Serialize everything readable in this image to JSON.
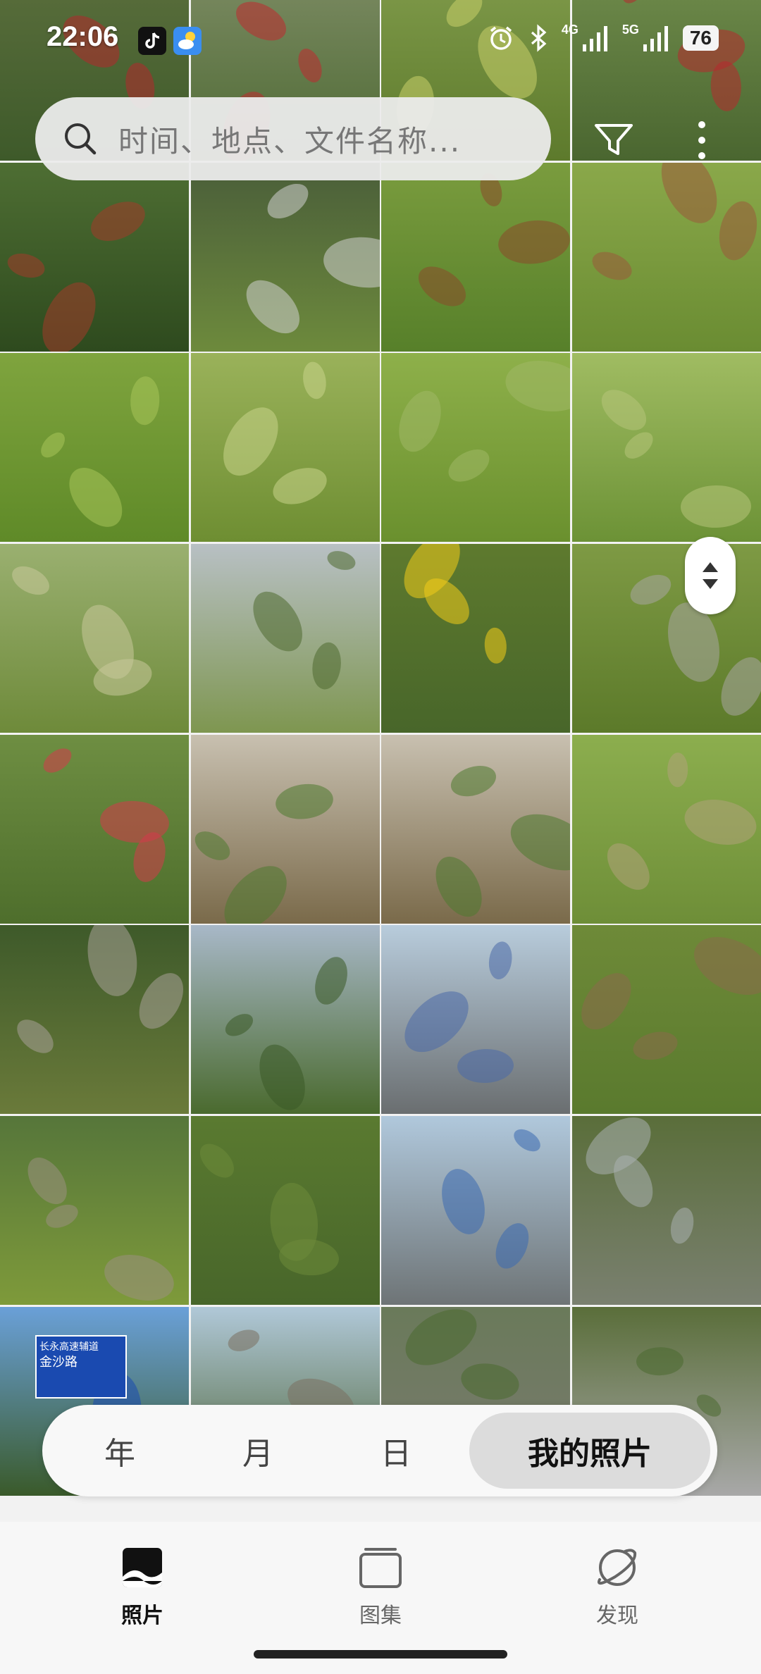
{
  "status_bar": {
    "time": "22:06",
    "signal_1": "4G",
    "signal_2": "5G",
    "battery": "76",
    "app_icons": [
      "tiktok-icon",
      "weather-icon"
    ],
    "right_icons": [
      "alarm-icon",
      "bluetooth-icon",
      "signal-4g-icon",
      "signal-5g-icon"
    ]
  },
  "search": {
    "placeholder": "时间、地点、文件名称..."
  },
  "view_switch": {
    "items": [
      "年",
      "月",
      "日",
      "我的照片"
    ],
    "selected": "我的照片"
  },
  "bottom_nav": {
    "items": [
      {
        "label": "照片",
        "icon": "photo-icon",
        "active": true
      },
      {
        "label": "图集",
        "icon": "albums-icon",
        "active": false
      },
      {
        "label": "发现",
        "icon": "discover-planet-icon",
        "active": false
      }
    ]
  },
  "photos": [
    {
      "top": "#5a6e3c",
      "bottom": "#3e5a2a",
      "accent": "#b3282c"
    },
    {
      "top": "#7b8a62",
      "bottom": "#4e6a34",
      "accent": "#c02a30"
    },
    {
      "top": "#7f9a4a",
      "bottom": "#5d7a2c",
      "accent": "#c9d06a"
    },
    {
      "top": "#6f8b4b",
      "bottom": "#4a6630",
      "accent": "#b72a2e"
    },
    {
      "top": "#4e6e33",
      "bottom": "#2e4a1e",
      "accent": "#a33a2a"
    },
    {
      "top": "#4a5e3a",
      "bottom": "#6d8a3c",
      "accent": "#d0d0d0"
    },
    {
      "top": "#7a9c3e",
      "bottom": "#57802a",
      "accent": "#8a4a2a"
    },
    {
      "top": "#8aa84a",
      "bottom": "#6a8c32",
      "accent": "#9a5a3a"
    },
    {
      "top": "#7fa43e",
      "bottom": "#5f8a28",
      "accent": "#a8c45a"
    },
    {
      "top": "#9ab25a",
      "bottom": "#6e8e32",
      "accent": "#c8d48a"
    },
    {
      "top": "#8eb04a",
      "bottom": "#6a902e",
      "accent": "#a0b866"
    },
    {
      "top": "#a0bc62",
      "bottom": "#6c9236",
      "accent": "#b6c47a"
    },
    {
      "top": "#9ab070",
      "bottom": "#6e8a3a",
      "accent": "#c8c89a"
    },
    {
      "top": "#b8c0c4",
      "bottom": "#7e9650",
      "accent": "#4e6a30"
    },
    {
      "top": "#5e7a2e",
      "bottom": "#48662a",
      "accent": "#f2cc1a"
    },
    {
      "top": "#7e9a44",
      "bottom": "#5c7a2a",
      "accent": "#a8a6a0"
    },
    {
      "top": "#6e8e42",
      "bottom": "#4e6e2c",
      "accent": "#d43a4a"
    },
    {
      "top": "#c8c0b0",
      "bottom": "#7a6a4a",
      "accent": "#4e7a30"
    },
    {
      "top": "#c8c0b0",
      "bottom": "#7a6a4a",
      "accent": "#4e7a30"
    },
    {
      "top": "#8cae4e",
      "bottom": "#6e8e38",
      "accent": "#b0a27a"
    },
    {
      "top": "#3e5a2a",
      "bottom": "#6a7a3a",
      "accent": "#a8a098"
    },
    {
      "top": "#a8b8c8",
      "bottom": "#4a6a2e",
      "accent": "#3a5a26"
    },
    {
      "top": "#b8ccdc",
      "bottom": "#6a6e70",
      "accent": "#4a6aa8"
    },
    {
      "top": "#6e8a38",
      "bottom": "#5a7a2e",
      "accent": "#8a6a4a"
    },
    {
      "top": "#56763a",
      "bottom": "#7e9a3a",
      "accent": "#9a9080"
    },
    {
      "top": "#5a7a30",
      "bottom": "#48662a",
      "accent": "#6e8a3a"
    },
    {
      "top": "#b0c8dc",
      "bottom": "#6e7476",
      "accent": "#3a6ab0"
    },
    {
      "top": "#5a6e3a",
      "bottom": "#7a8070",
      "accent": "#aab0b0"
    },
    {
      "top": "#6aa0d8",
      "bottom": "#3a5a2a",
      "accent": "#1a4ab0"
    },
    {
      "top": "#b0c8d8",
      "bottom": "#4a6030",
      "accent": "#7a7060"
    },
    {
      "top": "#6a7a5a",
      "bottom": "#7a7a70",
      "accent": "#4a6a30"
    },
    {
      "top": "#5a6e3a",
      "bottom": "#a8a8a8",
      "accent": "#4a6a30"
    }
  ],
  "sign_text": {
    "line1": "长永高速辅道",
    "line2": "金沙路"
  }
}
